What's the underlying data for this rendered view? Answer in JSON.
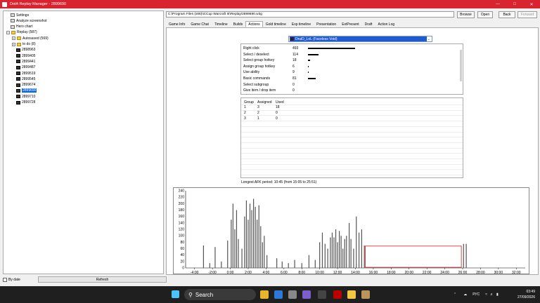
{
  "window": {
    "title": "DotA Replay Manager - 2899690"
  },
  "tree": {
    "items": [
      {
        "label": "Settings",
        "type": "setting"
      },
      {
        "label": "Analyze screenshot",
        "type": "setting"
      },
      {
        "label": "Hero chart",
        "type": "setting"
      },
      {
        "label": "Replay (587)",
        "type": "folder"
      },
      {
        "label": "Autosaved (569)",
        "type": "folder"
      },
      {
        "label": "to do (8)",
        "type": "folder"
      },
      {
        "label": "2898963",
        "type": "replay"
      },
      {
        "label": "2899405",
        "type": "replay"
      },
      {
        "label": "2899441",
        "type": "replay"
      },
      {
        "label": "2899487",
        "type": "replay"
      },
      {
        "label": "2899519",
        "type": "replay"
      },
      {
        "label": "2899545",
        "type": "replay"
      },
      {
        "label": "2899674",
        "type": "replay"
      },
      {
        "label": "2899690",
        "type": "replay",
        "selected": true
      },
      {
        "label": "2899710",
        "type": "replay"
      },
      {
        "label": "2899728",
        "type": "replay"
      }
    ]
  },
  "bottom": {
    "by_date_label": "By date",
    "refresh_label": "Refresh"
  },
  "toolbar": {
    "path": "C:\\Program Files (x86)\\iCCup Warcraft III\\Replay\\2899690.w3g",
    "browse": "Browse",
    "open": "Open",
    "back": "Back",
    "forward": "Forward"
  },
  "tabs": [
    "Game Info",
    "Game Chat",
    "Timeline",
    "Builds",
    "Actions",
    "Gold timeline",
    "Exp timeline",
    "Presentation",
    "ExtPresent",
    "Draft",
    "Action Log"
  ],
  "active_tab": "Actions",
  "player": {
    "selected": "DruiD_LoL (Faceless Void)",
    "hero_icon": "faceless-void-icon"
  },
  "actions": [
    {
      "name": "Right click",
      "value": 493,
      "fraction": 1.0
    },
    {
      "name": "Select / deselect",
      "value": 114,
      "fraction": 0.23
    },
    {
      "name": "Select group hotkey",
      "value": 18,
      "fraction": 0.04
    },
    {
      "name": "Assign group hotkey",
      "value": 6,
      "fraction": 0.012
    },
    {
      "name": "Use ability",
      "value": 9,
      "fraction": 0.018
    },
    {
      "name": "Basic commands",
      "value": 81,
      "fraction": 0.16
    },
    {
      "name": "Select subgroup",
      "value": 0,
      "fraction": 0
    },
    {
      "name": "Give item / drop item",
      "value": 0,
      "fraction": 0
    }
  ],
  "groups": {
    "headers": [
      "Group",
      "Assigned",
      "Used"
    ],
    "rows": [
      [
        "1",
        "3",
        "18"
      ],
      [
        "2",
        "2",
        "0"
      ],
      [
        "3",
        "1",
        "0"
      ]
    ]
  },
  "afk": "Longest AFK period: 10:45 (from 15:05 to 25:51)",
  "chart_data": {
    "type": "bar",
    "x_unit": "game time (minutes)",
    "xlim": [
      -5,
      33
    ],
    "ylim": [
      0,
      240
    ],
    "y_ticks": [
      0,
      20,
      40,
      60,
      80,
      100,
      120,
      140,
      160,
      180,
      200,
      220,
      240
    ],
    "x_ticks": [
      "-4:00",
      "-2:00",
      "0:00",
      "2:00",
      "4:00",
      "6:00",
      "8:00",
      "10:00",
      "12:00",
      "14:00",
      "16:00",
      "18:00",
      "20:00",
      "22:00",
      "24:00",
      "26:00",
      "28:00",
      "30:00",
      "32:00"
    ],
    "x_tick_values": [
      -4,
      -2,
      0,
      2,
      4,
      6,
      8,
      10,
      12,
      14,
      16,
      18,
      20,
      22,
      24,
      26,
      28,
      30,
      32
    ],
    "bars": [
      [
        -3.0,
        70
      ],
      [
        -2.3,
        15
      ],
      [
        -1.7,
        65
      ],
      [
        -1.0,
        20
      ],
      [
        -0.3,
        85
      ],
      [
        0.1,
        150
      ],
      [
        0.3,
        200
      ],
      [
        0.5,
        120
      ],
      [
        0.7,
        180
      ],
      [
        0.9,
        90
      ],
      [
        1.3,
        60
      ],
      [
        1.6,
        160
      ],
      [
        1.8,
        210
      ],
      [
        2.0,
        150
      ],
      [
        2.2,
        200
      ],
      [
        2.4,
        180
      ],
      [
        2.6,
        215
      ],
      [
        2.8,
        190
      ],
      [
        3.0,
        150
      ],
      [
        3.2,
        195
      ],
      [
        3.4,
        130
      ],
      [
        3.6,
        80
      ],
      [
        3.8,
        100
      ],
      [
        4.1,
        40
      ],
      [
        5.2,
        30
      ],
      [
        5.8,
        20
      ],
      [
        6.5,
        15
      ],
      [
        7.2,
        25
      ],
      [
        8.0,
        15
      ],
      [
        8.8,
        40
      ],
      [
        9.5,
        25
      ],
      [
        10.0,
        80
      ],
      [
        10.3,
        110
      ],
      [
        10.6,
        75
      ],
      [
        10.9,
        60
      ],
      [
        11.2,
        95
      ],
      [
        11.4,
        110
      ],
      [
        11.6,
        95
      ],
      [
        11.8,
        120
      ],
      [
        12.0,
        80
      ],
      [
        12.2,
        115
      ],
      [
        12.4,
        100
      ],
      [
        12.6,
        60
      ],
      [
        12.8,
        90
      ],
      [
        13.0,
        100
      ],
      [
        13.3,
        140
      ],
      [
        13.5,
        90
      ],
      [
        13.8,
        60
      ],
      [
        14.1,
        160
      ],
      [
        14.4,
        110
      ],
      [
        14.7,
        120
      ],
      [
        15.0,
        70
      ],
      [
        26.1,
        75
      ],
      [
        26.4,
        75
      ]
    ],
    "afk_highlight": {
      "from": 15.1,
      "to": 25.85,
      "color": "#d11a1a"
    }
  },
  "taskbar": {
    "search": "Search",
    "lang": "РУС",
    "time": "03:49",
    "date": "27/09/2026"
  }
}
